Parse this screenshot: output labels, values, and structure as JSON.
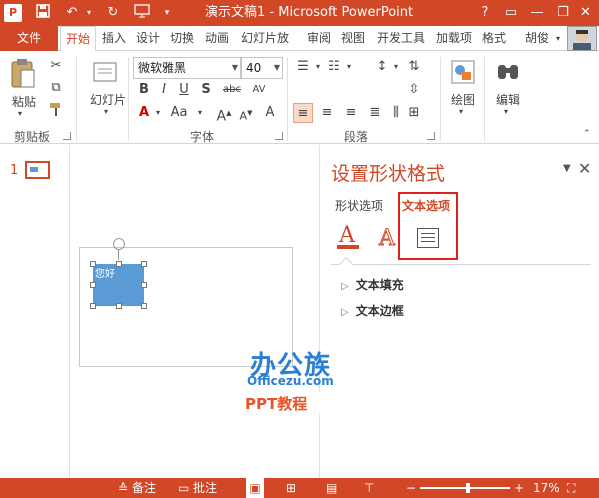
{
  "colors": {
    "accent": "#d24726",
    "shape_fill": "#5b9bd5",
    "highlight_border": "#e02020",
    "watermark_blue": "#2a7fd4"
  },
  "titlebar": {
    "title": "演示文稿1 - Microsoft PowerPoint",
    "icons": [
      "powerpoint-icon",
      "save-icon",
      "undo-icon",
      "redo-icon",
      "start-from-beginning-icon",
      "customize-qat-icon"
    ],
    "window_buttons": [
      "?",
      "□",
      "—",
      "□",
      "✕"
    ]
  },
  "tabs": {
    "file": "文件",
    "home": "开始",
    "insert": "插入",
    "design": "设计",
    "transitions": "切换",
    "animations": "动画",
    "slideshow": "幻灯片放",
    "review": "审阅",
    "view": "视图",
    "developer": "开发工具",
    "addins": "加载项",
    "format": "格式",
    "user": "胡俊"
  },
  "ribbon": {
    "paste": "粘贴",
    "clipboard_group": "剪贴板",
    "slides_button": "幻灯片",
    "font_name": "微软雅黑",
    "font_size": "40",
    "font_group": "字体",
    "paragraph_group": "段落",
    "drawing": "绘图",
    "editing": "编辑",
    "bold": "B",
    "italic": "I",
    "underline": "U",
    "shadow": "S",
    "strike": "abc",
    "spacing": "AV",
    "font_color": "A",
    "font_grow": "Aa",
    "clear": "A"
  },
  "thumbs": {
    "slide_number": "1"
  },
  "canvas": {
    "shape_text": "您好"
  },
  "format_pane": {
    "title": "设置形状格式",
    "tab_shape": "形状选项",
    "tab_text": "文本选项",
    "section_fill": "文本填充",
    "section_outline": "文本边框"
  },
  "watermark": {
    "logo": "办公族",
    "url": "Officezu.com",
    "sub": "PPT教程"
  },
  "statusbar": {
    "notes": "备注",
    "comments": "批注",
    "zoom": "17%"
  }
}
